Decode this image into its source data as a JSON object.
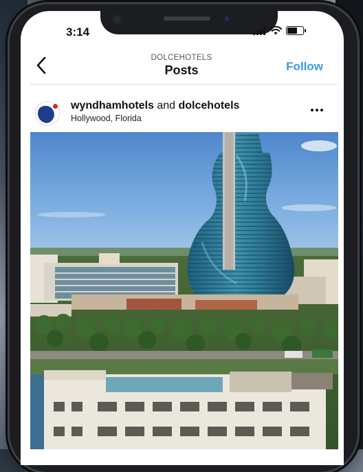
{
  "status": {
    "time": "3:14"
  },
  "header": {
    "account": "DOLCEHOTELS",
    "title": "Posts",
    "follow_label": "Follow"
  },
  "post": {
    "author_primary": "wyndhamhotels",
    "author_joiner": " and ",
    "author_secondary": "dolcehotels",
    "location": "Hollywood, Florida"
  },
  "colors": {
    "accent": "#3897f0",
    "sky": "#6fa3dc",
    "tower_glass": "#2f7d9a"
  },
  "icons": [
    "back-chevron-icon",
    "more-options-icon",
    "signal-icon",
    "wifi-icon",
    "battery-icon"
  ]
}
